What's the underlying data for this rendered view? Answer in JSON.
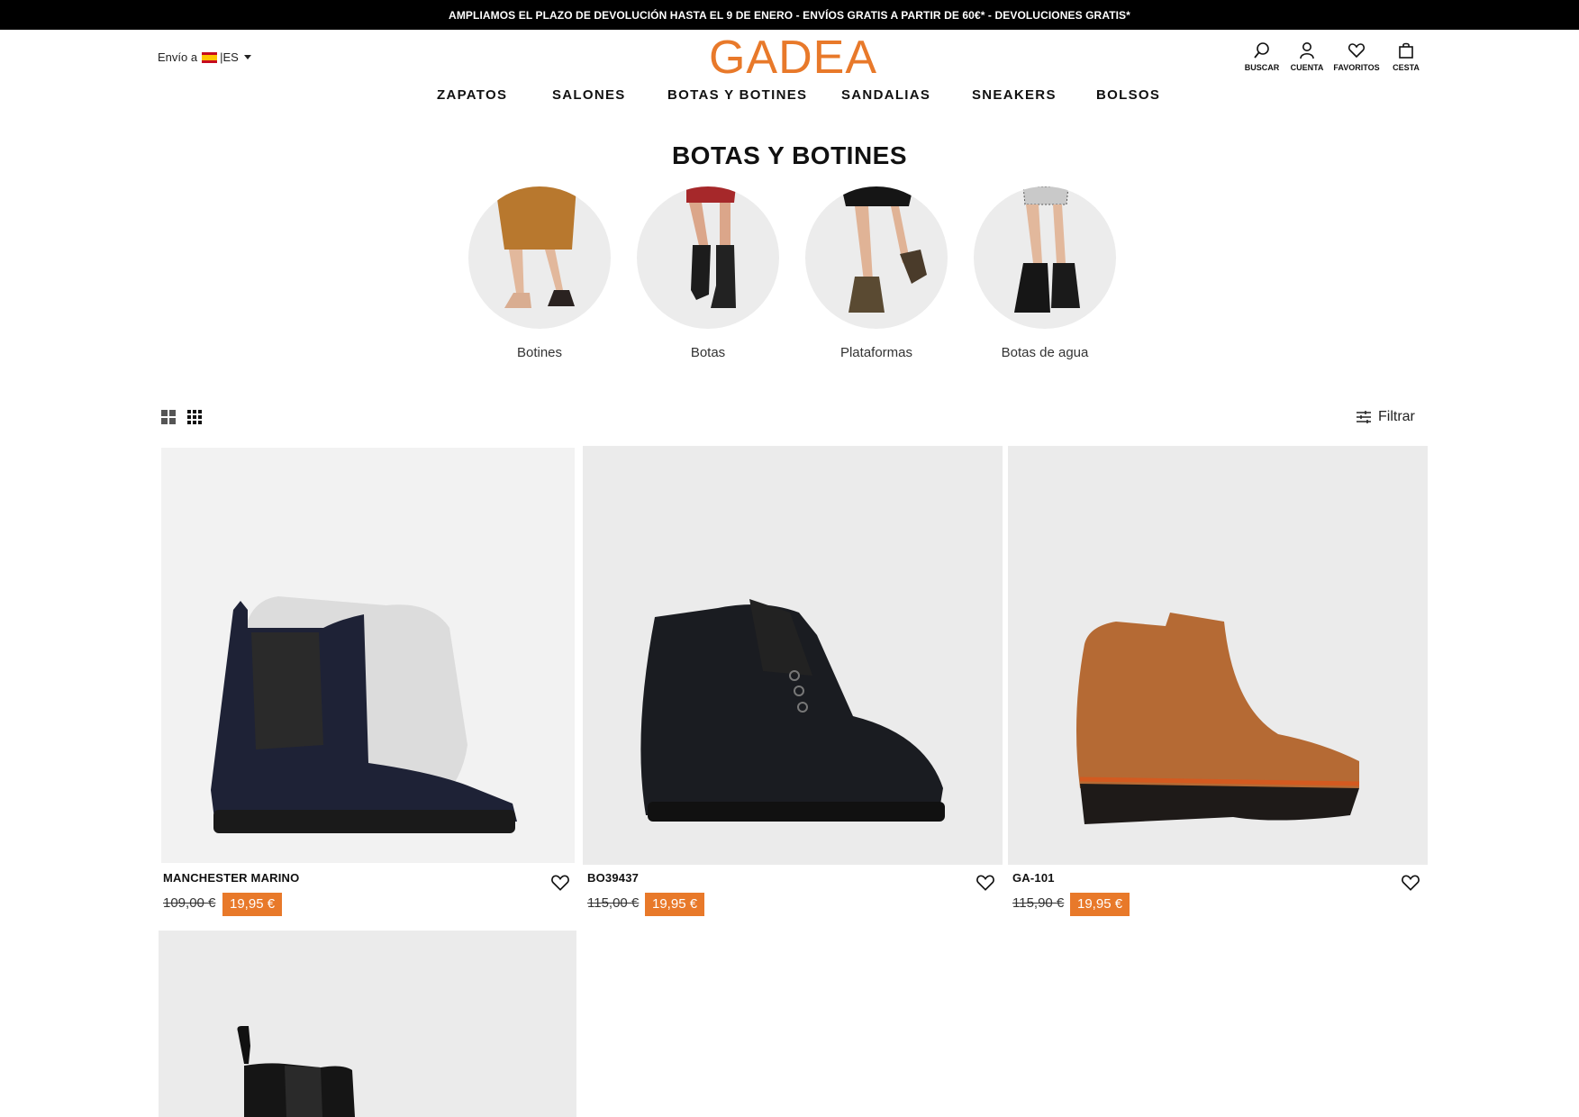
{
  "announcement": "AMPLIAMOS EL PLAZO DE DEVOLUCIÓN HASTA EL 9 DE ENERO - ENVÍOS GRATIS A PARTIR DE 60€* - DEVOLUCIONES GRATIS*",
  "shipping": {
    "label": "Envío a",
    "country": "|ES"
  },
  "logo": "GADEA",
  "utility": [
    {
      "label": "BUSCAR",
      "icon": "search-icon"
    },
    {
      "label": "CUENTA",
      "icon": "user-icon"
    },
    {
      "label": "FAVORITOS",
      "icon": "heart-icon"
    },
    {
      "label": "CESTA",
      "icon": "bag-icon"
    }
  ],
  "nav": [
    "ZAPATOS",
    "SALONES",
    "BOTAS Y BOTINES",
    "SANDALIAS",
    "SNEAKERS",
    "BOLSOS"
  ],
  "page_title": "BOTAS Y BOTINES",
  "categories": [
    "Botines",
    "Botas",
    "Plataformas",
    "Botas de agua"
  ],
  "filter_label": "Filtrar",
  "products": [
    {
      "name": "MANCHESTER MARINO",
      "old_price": "109,00 €",
      "price": "19,95 €",
      "color": "#1e2236"
    },
    {
      "name": "BO39437",
      "old_price": "115,00 €",
      "price": "19,95 €",
      "color": "#1a1c21"
    },
    {
      "name": "GA-101",
      "old_price": "115,90 €",
      "price": "19,95 €",
      "color": "#b56a34"
    },
    {
      "name": "",
      "old_price": "",
      "price": "",
      "color": "#111111"
    }
  ],
  "colors": {
    "accent": "#e8792a",
    "announcement_bg": "#000000"
  }
}
